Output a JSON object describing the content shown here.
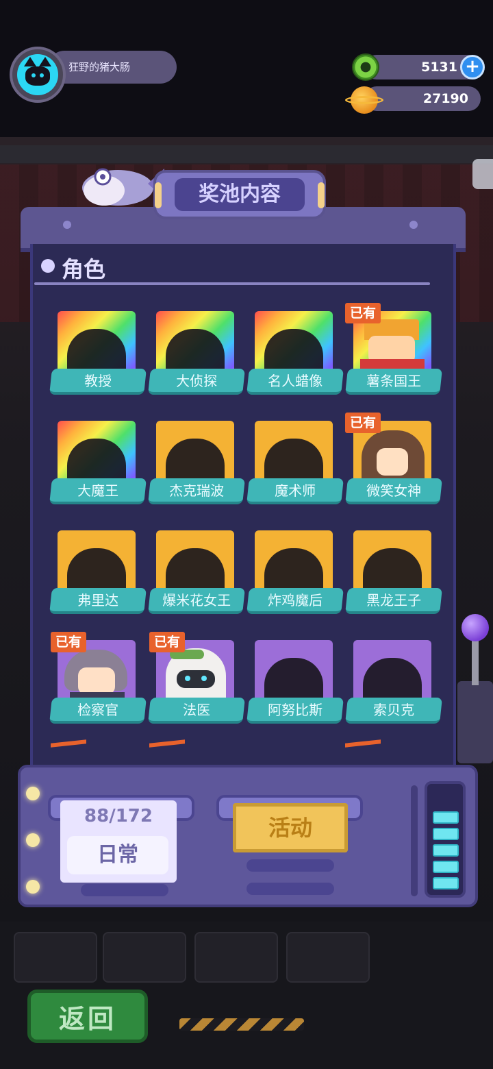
{
  "header": {
    "player_name": "狂野的猪大肠",
    "currency_green": "5131",
    "currency_gold": "27190",
    "add_currency": "+"
  },
  "panel": {
    "title": "奖池内容",
    "section": "角色",
    "owned_badge": "已有"
  },
  "characters": [
    {
      "name": "教授",
      "rarity": "rainbow",
      "owned": false
    },
    {
      "name": "大侦探",
      "rarity": "rainbow",
      "owned": false
    },
    {
      "name": "名人蜡像",
      "rarity": "rainbow",
      "owned": false
    },
    {
      "name": "薯条国王",
      "rarity": "rainbow",
      "owned": true
    },
    {
      "name": "大魔王",
      "rarity": "rainbow",
      "owned": false
    },
    {
      "name": "杰克瑞波",
      "rarity": "gold",
      "owned": false
    },
    {
      "name": "魔术师",
      "rarity": "gold",
      "owned": false
    },
    {
      "name": "微笑女神",
      "rarity": "gold",
      "owned": true
    },
    {
      "name": "弗里达",
      "rarity": "gold",
      "owned": false
    },
    {
      "name": "爆米花女王",
      "rarity": "gold",
      "owned": false
    },
    {
      "name": "炸鸡魔后",
      "rarity": "gold",
      "owned": false
    },
    {
      "name": "黑龙王子",
      "rarity": "gold",
      "owned": false
    },
    {
      "name": "检察官",
      "rarity": "purple",
      "owned": true
    },
    {
      "name": "法医",
      "rarity": "purple",
      "owned": true
    },
    {
      "name": "阿努比斯",
      "rarity": "purple",
      "owned": false
    },
    {
      "name": "索贝克",
      "rarity": "purple",
      "owned": false
    }
  ],
  "controls": {
    "progress": "88/172",
    "mode_daily": "日常",
    "mode_event": "活动",
    "back": "返回"
  },
  "colors": {
    "panel": "#2c2a55",
    "label": "#3fb6b7",
    "badge": "#e8622c",
    "gold_frame": "#f4b234",
    "purple_frame": "#9c6ed8"
  }
}
